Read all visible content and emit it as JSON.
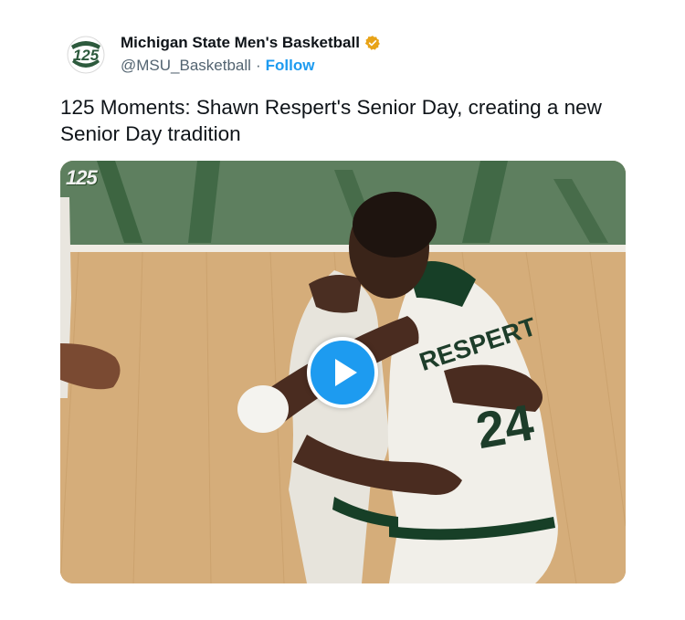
{
  "account": {
    "display_name": "Michigan State Men's Basketball",
    "handle": "@MSU_Basketball",
    "separator": "·",
    "follow_label": "Follow",
    "verified_icon": "verified-badge-icon",
    "avatar_text": "125",
    "verified_color": "#e8a317"
  },
  "tweet": {
    "text": "125 Moments: Shawn Respert's Senior Day, creating a new Senior Day tradition"
  },
  "media": {
    "watermark": "125",
    "jersey_name": "RESPERT",
    "jersey_number": "24",
    "play_icon": "play-icon",
    "accent_color": "#1d9bf0"
  }
}
